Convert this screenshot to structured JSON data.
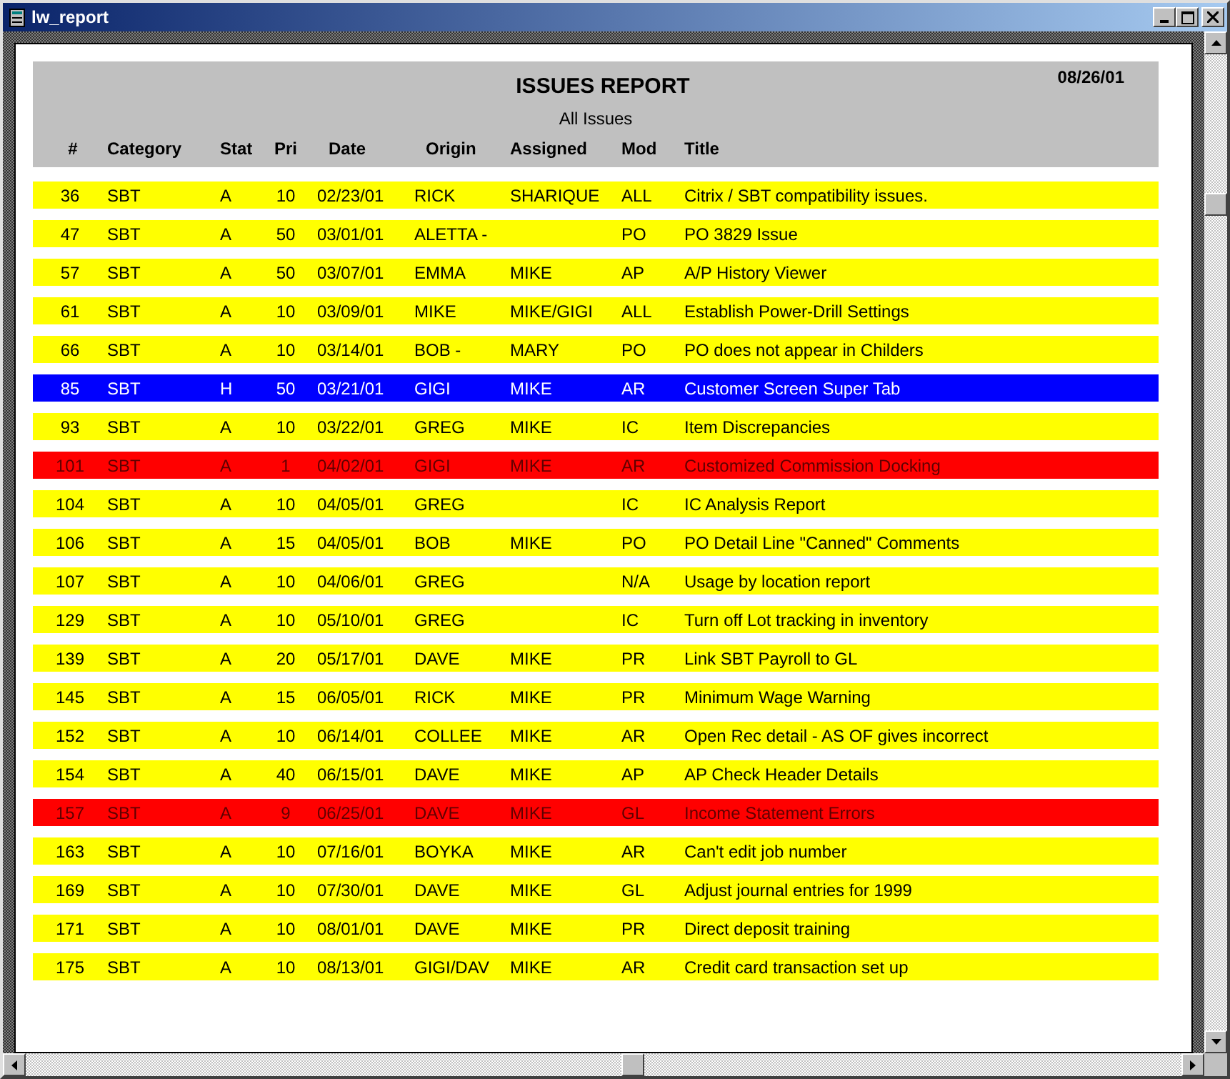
{
  "window": {
    "title": "lw_report"
  },
  "report": {
    "title": "ISSUES REPORT",
    "subtitle": "All Issues",
    "date": "08/26/01",
    "columns": [
      "#",
      "Category",
      "Stat",
      "Pri",
      "Date",
      "Origin",
      "Assigned",
      "Mod",
      "Title"
    ],
    "rows": [
      {
        "color": "#ffff00",
        "cells": [
          "36",
          "SBT",
          "A",
          "10",
          "02/23/01",
          "RICK",
          "SHARIQUE",
          "ALL",
          "Citrix / SBT compatibility issues."
        ]
      },
      {
        "color": "#ffff00",
        "cells": [
          "47",
          "SBT",
          "A",
          "50",
          "03/01/01",
          "ALETTA -",
          "",
          "PO",
          "PO 3829 Issue"
        ]
      },
      {
        "color": "#ffff00",
        "cells": [
          "57",
          "SBT",
          "A",
          "50",
          "03/07/01",
          "EMMA",
          "MIKE",
          "AP",
          "A/P History Viewer"
        ]
      },
      {
        "color": "#ffff00",
        "cells": [
          "61",
          "SBT",
          "A",
          "10",
          "03/09/01",
          "MIKE",
          "MIKE/GIGI",
          "ALL",
          "Establish Power-Drill Settings"
        ]
      },
      {
        "color": "#ffff00",
        "cells": [
          "66",
          "SBT",
          "A",
          "10",
          "03/14/01",
          "BOB -",
          "MARY",
          "PO",
          "PO does not appear in Childers"
        ]
      },
      {
        "color": "#0000ff",
        "cells": [
          "85",
          "SBT",
          "H",
          "50",
          "03/21/01",
          "GIGI",
          "MIKE",
          "AR",
          "Customer Screen Super Tab"
        ]
      },
      {
        "color": "#ffff00",
        "cells": [
          "93",
          "SBT",
          "A",
          "10",
          "03/22/01",
          "GREG",
          "MIKE",
          "IC",
          "Item Discrepancies"
        ]
      },
      {
        "color": "#ff0000",
        "cells": [
          "101",
          "SBT",
          "A",
          "1",
          "04/02/01",
          "GIGI",
          "MIKE",
          "AR",
          "Customized Commission Docking"
        ]
      },
      {
        "color": "#ffff00",
        "cells": [
          "104",
          "SBT",
          "A",
          "10",
          "04/05/01",
          "GREG",
          "",
          "IC",
          "IC Analysis Report"
        ]
      },
      {
        "color": "#ffff00",
        "cells": [
          "106",
          "SBT",
          "A",
          "15",
          "04/05/01",
          "BOB",
          "MIKE",
          "PO",
          "PO Detail Line \"Canned\" Comments"
        ]
      },
      {
        "color": "#ffff00",
        "cells": [
          "107",
          "SBT",
          "A",
          "10",
          "04/06/01",
          "GREG",
          "",
          "N/A",
          "Usage by location report"
        ]
      },
      {
        "color": "#ffff00",
        "cells": [
          "129",
          "SBT",
          "A",
          "10",
          "05/10/01",
          "GREG",
          "",
          "IC",
          "Turn off Lot tracking in inventory"
        ]
      },
      {
        "color": "#ffff00",
        "cells": [
          "139",
          "SBT",
          "A",
          "20",
          "05/17/01",
          "DAVE",
          "MIKE",
          "PR",
          "Link SBT Payroll to GL"
        ]
      },
      {
        "color": "#ffff00",
        "cells": [
          "145",
          "SBT",
          "A",
          "15",
          "06/05/01",
          "RICK",
          "MIKE",
          "PR",
          "Minimum Wage Warning"
        ]
      },
      {
        "color": "#ffff00",
        "cells": [
          "152",
          "SBT",
          "A",
          "10",
          "06/14/01",
          "COLLEE",
          "MIKE",
          "AR",
          "Open Rec detail - AS OF gives incorrect"
        ]
      },
      {
        "color": "#ffff00",
        "cells": [
          "154",
          "SBT",
          "A",
          "40",
          "06/15/01",
          "DAVE",
          "MIKE",
          "AP",
          "AP Check Header Details"
        ]
      },
      {
        "color": "#ff0000",
        "cells": [
          "157",
          "SBT",
          "A",
          "9",
          "06/25/01",
          "DAVE",
          "MIKE",
          "GL",
          "Income Statement Errors"
        ]
      },
      {
        "color": "#ffff00",
        "cells": [
          "163",
          "SBT",
          "A",
          "10",
          "07/16/01",
          "BOYKA",
          "MIKE",
          "AR",
          "Can't edit job number"
        ]
      },
      {
        "color": "#ffff00",
        "cells": [
          "169",
          "SBT",
          "A",
          "10",
          "07/30/01",
          "DAVE",
          "MIKE",
          "GL",
          "Adjust journal entries for 1999"
        ]
      },
      {
        "color": "#ffff00",
        "cells": [
          "171",
          "SBT",
          "A",
          "10",
          "08/01/01",
          "DAVE",
          "MIKE",
          "PR",
          "Direct deposit training"
        ]
      },
      {
        "color": "#ffff00",
        "cells": [
          "175",
          "SBT",
          "A",
          "10",
          "08/13/01",
          "GIGI/DAV",
          "MIKE",
          "AR",
          "Credit card transaction set up"
        ]
      }
    ]
  }
}
